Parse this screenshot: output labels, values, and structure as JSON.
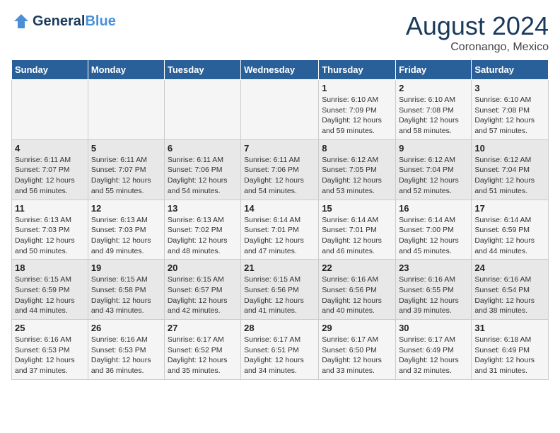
{
  "header": {
    "logo_general": "General",
    "logo_blue": "Blue",
    "month_year": "August 2024",
    "location": "Coronango, Mexico"
  },
  "weekdays": [
    "Sunday",
    "Monday",
    "Tuesday",
    "Wednesday",
    "Thursday",
    "Friday",
    "Saturday"
  ],
  "weeks": [
    [
      {
        "day": "",
        "info": ""
      },
      {
        "day": "",
        "info": ""
      },
      {
        "day": "",
        "info": ""
      },
      {
        "day": "",
        "info": ""
      },
      {
        "day": "1",
        "info": "Sunrise: 6:10 AM\nSunset: 7:09 PM\nDaylight: 12 hours\nand 59 minutes."
      },
      {
        "day": "2",
        "info": "Sunrise: 6:10 AM\nSunset: 7:08 PM\nDaylight: 12 hours\nand 58 minutes."
      },
      {
        "day": "3",
        "info": "Sunrise: 6:10 AM\nSunset: 7:08 PM\nDaylight: 12 hours\nand 57 minutes."
      }
    ],
    [
      {
        "day": "4",
        "info": "Sunrise: 6:11 AM\nSunset: 7:07 PM\nDaylight: 12 hours\nand 56 minutes."
      },
      {
        "day": "5",
        "info": "Sunrise: 6:11 AM\nSunset: 7:07 PM\nDaylight: 12 hours\nand 55 minutes."
      },
      {
        "day": "6",
        "info": "Sunrise: 6:11 AM\nSunset: 7:06 PM\nDaylight: 12 hours\nand 54 minutes."
      },
      {
        "day": "7",
        "info": "Sunrise: 6:11 AM\nSunset: 7:06 PM\nDaylight: 12 hours\nand 54 minutes."
      },
      {
        "day": "8",
        "info": "Sunrise: 6:12 AM\nSunset: 7:05 PM\nDaylight: 12 hours\nand 53 minutes."
      },
      {
        "day": "9",
        "info": "Sunrise: 6:12 AM\nSunset: 7:04 PM\nDaylight: 12 hours\nand 52 minutes."
      },
      {
        "day": "10",
        "info": "Sunrise: 6:12 AM\nSunset: 7:04 PM\nDaylight: 12 hours\nand 51 minutes."
      }
    ],
    [
      {
        "day": "11",
        "info": "Sunrise: 6:13 AM\nSunset: 7:03 PM\nDaylight: 12 hours\nand 50 minutes."
      },
      {
        "day": "12",
        "info": "Sunrise: 6:13 AM\nSunset: 7:03 PM\nDaylight: 12 hours\nand 49 minutes."
      },
      {
        "day": "13",
        "info": "Sunrise: 6:13 AM\nSunset: 7:02 PM\nDaylight: 12 hours\nand 48 minutes."
      },
      {
        "day": "14",
        "info": "Sunrise: 6:14 AM\nSunset: 7:01 PM\nDaylight: 12 hours\nand 47 minutes."
      },
      {
        "day": "15",
        "info": "Sunrise: 6:14 AM\nSunset: 7:01 PM\nDaylight: 12 hours\nand 46 minutes."
      },
      {
        "day": "16",
        "info": "Sunrise: 6:14 AM\nSunset: 7:00 PM\nDaylight: 12 hours\nand 45 minutes."
      },
      {
        "day": "17",
        "info": "Sunrise: 6:14 AM\nSunset: 6:59 PM\nDaylight: 12 hours\nand 44 minutes."
      }
    ],
    [
      {
        "day": "18",
        "info": "Sunrise: 6:15 AM\nSunset: 6:59 PM\nDaylight: 12 hours\nand 44 minutes."
      },
      {
        "day": "19",
        "info": "Sunrise: 6:15 AM\nSunset: 6:58 PM\nDaylight: 12 hours\nand 43 minutes."
      },
      {
        "day": "20",
        "info": "Sunrise: 6:15 AM\nSunset: 6:57 PM\nDaylight: 12 hours\nand 42 minutes."
      },
      {
        "day": "21",
        "info": "Sunrise: 6:15 AM\nSunset: 6:56 PM\nDaylight: 12 hours\nand 41 minutes."
      },
      {
        "day": "22",
        "info": "Sunrise: 6:16 AM\nSunset: 6:56 PM\nDaylight: 12 hours\nand 40 minutes."
      },
      {
        "day": "23",
        "info": "Sunrise: 6:16 AM\nSunset: 6:55 PM\nDaylight: 12 hours\nand 39 minutes."
      },
      {
        "day": "24",
        "info": "Sunrise: 6:16 AM\nSunset: 6:54 PM\nDaylight: 12 hours\nand 38 minutes."
      }
    ],
    [
      {
        "day": "25",
        "info": "Sunrise: 6:16 AM\nSunset: 6:53 PM\nDaylight: 12 hours\nand 37 minutes."
      },
      {
        "day": "26",
        "info": "Sunrise: 6:16 AM\nSunset: 6:53 PM\nDaylight: 12 hours\nand 36 minutes."
      },
      {
        "day": "27",
        "info": "Sunrise: 6:17 AM\nSunset: 6:52 PM\nDaylight: 12 hours\nand 35 minutes."
      },
      {
        "day": "28",
        "info": "Sunrise: 6:17 AM\nSunset: 6:51 PM\nDaylight: 12 hours\nand 34 minutes."
      },
      {
        "day": "29",
        "info": "Sunrise: 6:17 AM\nSunset: 6:50 PM\nDaylight: 12 hours\nand 33 minutes."
      },
      {
        "day": "30",
        "info": "Sunrise: 6:17 AM\nSunset: 6:49 PM\nDaylight: 12 hours\nand 32 minutes."
      },
      {
        "day": "31",
        "info": "Sunrise: 6:18 AM\nSunset: 6:49 PM\nDaylight: 12 hours\nand 31 minutes."
      }
    ]
  ]
}
